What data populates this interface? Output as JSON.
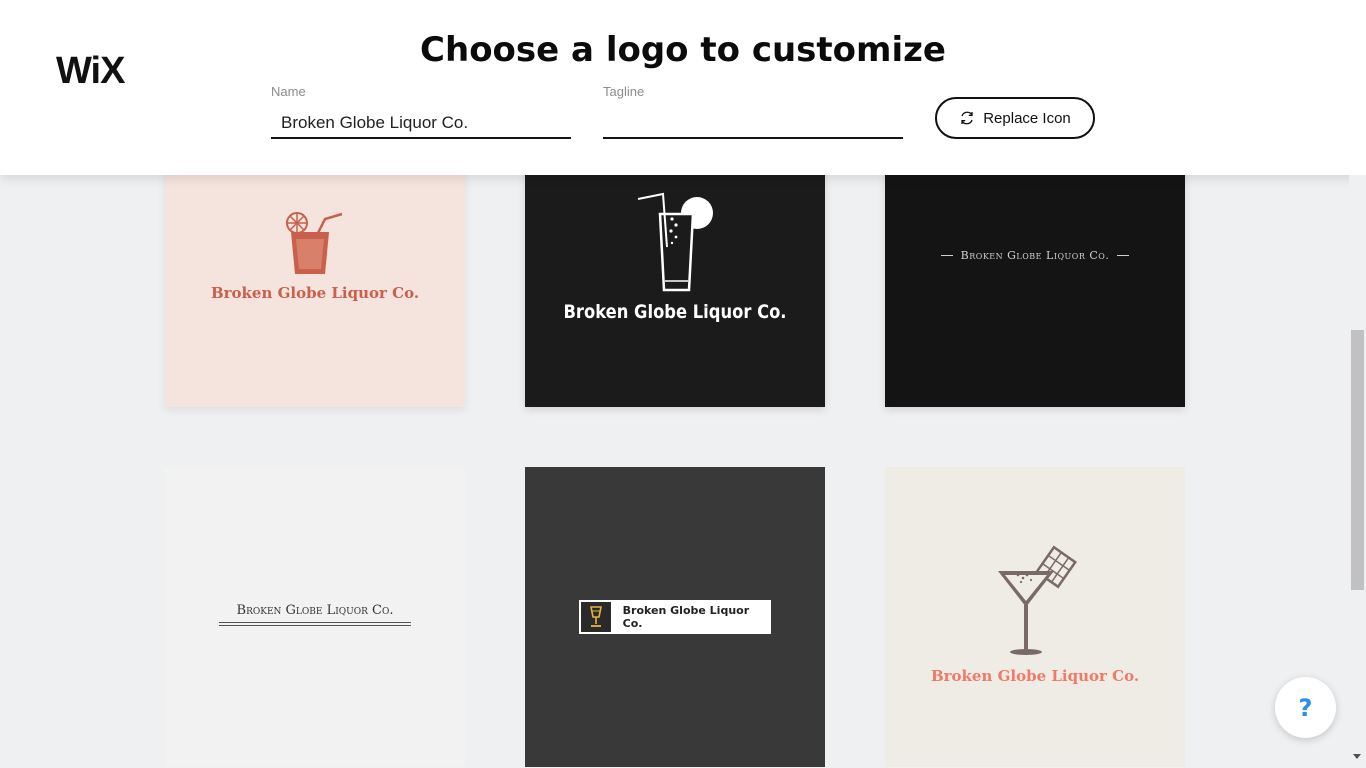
{
  "header": {
    "brand": "WiX",
    "title": "Choose a logo to customize",
    "name_field": {
      "label": "Name",
      "value": "Broken Globe Liquor Co."
    },
    "tagline_field": {
      "label": "Tagline",
      "value": ""
    },
    "replace_button": {
      "label": "Replace Icon",
      "icon": "refresh-icon"
    }
  },
  "logos": [
    {
      "text": "Broken Globe Liquor Co.",
      "icon": "drink-glass-icon",
      "bg": "#f5e3dd",
      "color": "#c8604b"
    },
    {
      "text": "Broken Globe Liquor Co.",
      "icon": "soda-straw-icon",
      "bg": "#1b1b1b",
      "color": "#ffffff"
    },
    {
      "text": "Broken Globe Liquor Co.",
      "icon": "",
      "bg": "#141414",
      "color": "#cfcfcf"
    },
    {
      "text": "Broken Globe Liquor Co.",
      "icon": "",
      "bg": "#f2f2f2",
      "color": "#333333"
    },
    {
      "text": "Broken Globe Liquor Co.",
      "icon": "goblet-icon",
      "bg": "#393939",
      "color": "#222222"
    },
    {
      "text": "Broken Globe Liquor Co.",
      "icon": "cocktail-chocolate-icon",
      "bg": "#efebe5",
      "color": "#ef7a69"
    }
  ],
  "help": {
    "label": "?"
  }
}
